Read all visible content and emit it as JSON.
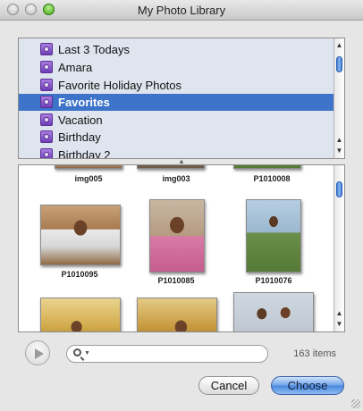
{
  "window": {
    "title": "My Photo Library"
  },
  "albums": [
    {
      "label": "Last 3 Todays",
      "selected": false
    },
    {
      "label": "Amara",
      "selected": false
    },
    {
      "label": "Favorite Holiday Photos",
      "selected": false
    },
    {
      "label": "Favorites",
      "selected": true
    },
    {
      "label": "Vacation",
      "selected": false
    },
    {
      "label": "Birthday",
      "selected": false
    },
    {
      "label": "Birthday 2",
      "selected": false
    }
  ],
  "photos": [
    {
      "caption": "img005"
    },
    {
      "caption": "img003"
    },
    {
      "caption": "P1010008"
    },
    {
      "caption": "P1010095"
    },
    {
      "caption": "P1010085"
    },
    {
      "caption": "P1010076"
    },
    {
      "caption": ""
    },
    {
      "caption": ""
    },
    {
      "caption": ""
    }
  ],
  "search": {
    "placeholder": "",
    "value": ""
  },
  "status": {
    "item_count": "163 items"
  },
  "buttons": {
    "cancel": "Cancel",
    "choose": "Choose"
  },
  "colors": {
    "selection": "#3d73c9",
    "default_button": "#4a87dd"
  }
}
